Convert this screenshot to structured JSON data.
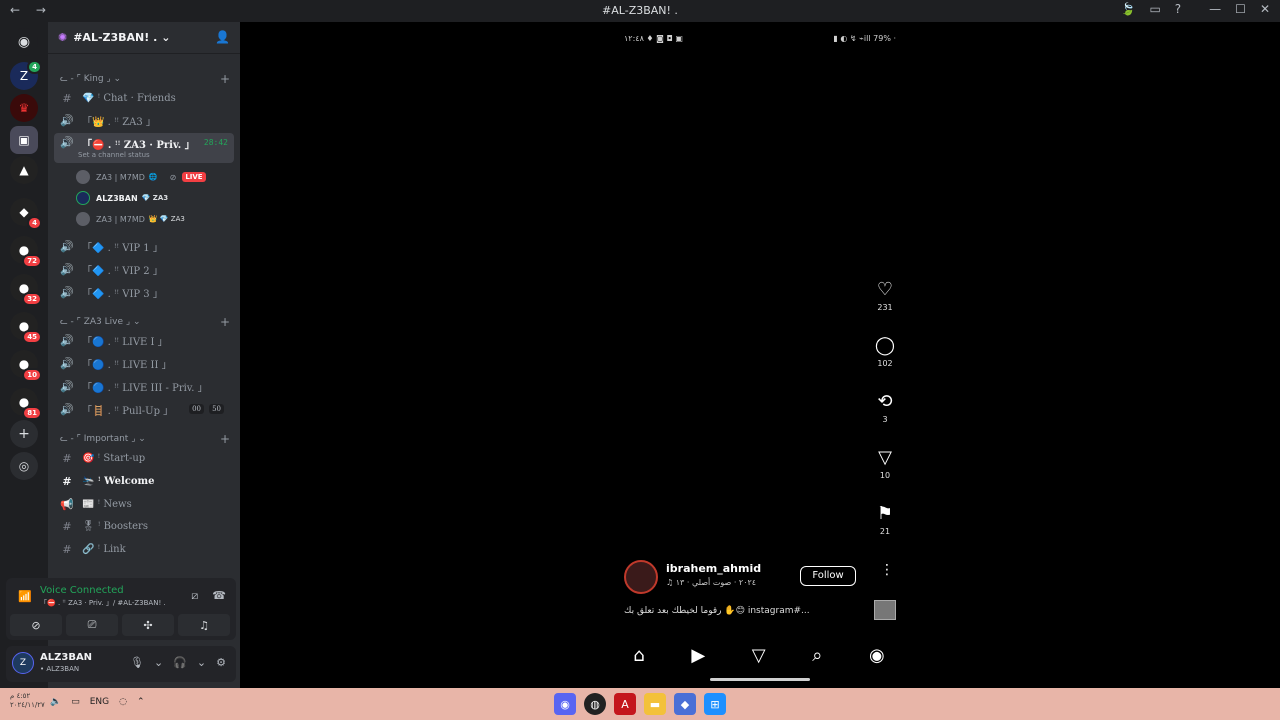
{
  "window": {
    "title": "#AL-Z3BAN! .",
    "nav": "← →",
    "right_icons": [
      "leaf-icon",
      "inbox-icon",
      "help-icon"
    ],
    "controls": [
      "—",
      "☐",
      "✕"
    ]
  },
  "servers": [
    {
      "icon": "Z",
      "badge": ""
    },
    {
      "icon": "♛",
      "badge": ""
    },
    {
      "icon": "▣",
      "badge": ""
    },
    {
      "icon": "▲",
      "badge": ""
    },
    {
      "icon": "◆",
      "badge": "4"
    },
    {
      "icon": "●",
      "badge": "72"
    },
    {
      "icon": "●",
      "badge": "32"
    },
    {
      "icon": "●",
      "badge": "45"
    },
    {
      "icon": "●",
      "badge": "10"
    },
    {
      "icon": "●",
      "badge": "81"
    }
  ],
  "guild": {
    "name": "#AL-Z3BAN! .",
    "chevron": "⌄",
    "invite_icon": "add-member-icon"
  },
  "categories": {
    "king": "King",
    "za3live": "ZA3 Live",
    "important": "Important"
  },
  "channels": {
    "chat_friends": "💎 ꜝ Chat · Friends",
    "za3": "「👑 . ꜝꜝ ZA3 」",
    "priv": "「⛔ . ꜝꜝ ZA3 · Priv. 」",
    "priv_timer": "28:42",
    "priv_status": "Set a channel status",
    "vip1": "「🔷 . ꜝꜝ VIP 1 」",
    "vip2": "「🔷 . ꜝꜝ VIP 2 」",
    "vip3": "「🔷 . ꜝꜝ VIP 3 」",
    "live1": "「🔵 . ꜝꜝ LIVE I 」",
    "live2": "「🔵 . ꜝꜝ LIVE II 」",
    "live3": "「🔵 . ꜝꜝ LIVE III - Priv. 」",
    "pullup": "「🪜 . ꜝꜝ Pull-Up 」",
    "pullup_count_a": "00",
    "pullup_count_b": "50",
    "startup": "🎯 ꜝ Start-up",
    "welcome": "🛬 ꜝ Welcome",
    "news": "📰 ꜝ News",
    "boosters": "🎖 ꜝ Boosters",
    "link": "🔗 ꜝ Link"
  },
  "voice_users": [
    {
      "name": "ZA3 | M7MD",
      "extra": "🌐",
      "live": "LIVE"
    },
    {
      "name": "ALZ3BAN",
      "extra": "💎 ZA3",
      "live": ""
    },
    {
      "name": "ZA3 | M7MD",
      "extra": "👑 💎 ZA3",
      "live": ""
    }
  ],
  "voice": {
    "status": "Voice Connected",
    "sub": "「⛔ . ꜝꜝ ZA3 · Priv. 」/ #AL-Z3BAN! ."
  },
  "user": {
    "name": "ALZ3BAN",
    "sub": "• ALZ3BAN",
    "initial": "Z"
  },
  "phone": {
    "status_left": "١٢:٤٨ ♦ ◙ ◘ ▣",
    "status_right": "▮ ◐ ↯ ⌁ill 79% ·",
    "likes": "231",
    "comments": "102",
    "reposts": "3",
    "shares": "10",
    "saves": "21",
    "username": "ibrahem_ahmid",
    "meta": "♫ ٢٠٢٤ · صوت أصلي · ١٣",
    "follow": "Follow",
    "caption": "رقوما لخيطك بعد تعلق بك ✋😊 instagram#..."
  },
  "taskbar": {
    "date": "٤:٥٢ م",
    "date2": "٢٠٢٤/١١/٢٧",
    "lang": "ENG"
  }
}
